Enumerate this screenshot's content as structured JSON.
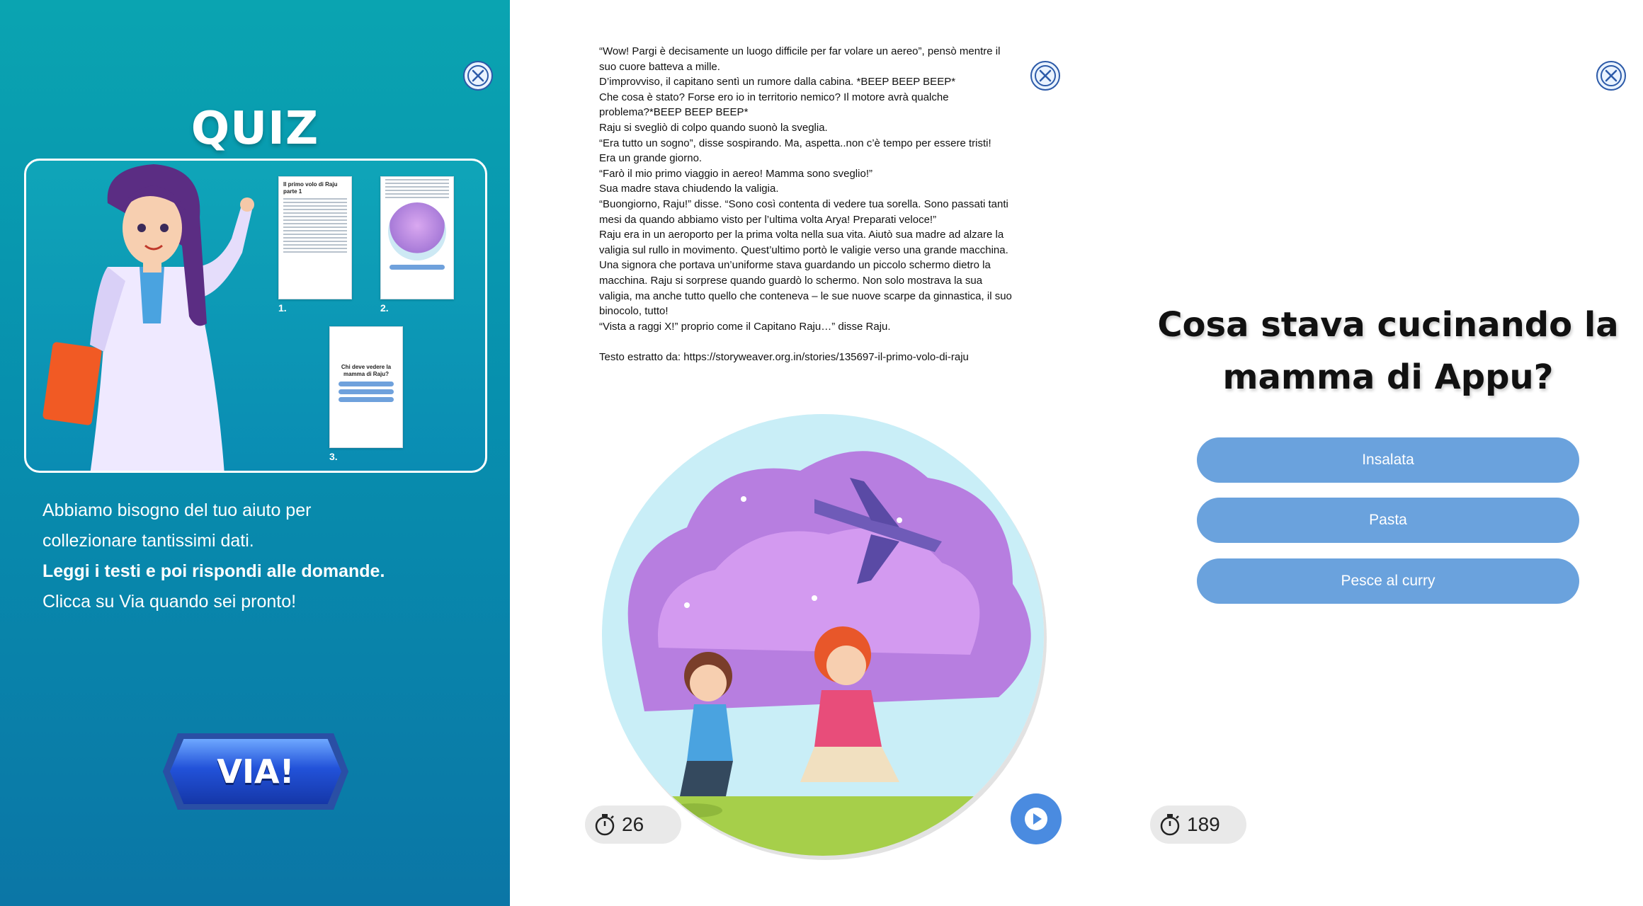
{
  "left": {
    "title": "QUIZ",
    "preview": {
      "thumb1_title": "Il primo volo di Raju parte 1",
      "thumb3_title": "Chi deve vedere la mamma di Raju?",
      "labels": [
        "1.",
        "2.",
        "3."
      ]
    },
    "intro_line1": "Abbiamo bisogno del tuo aiuto per",
    "intro_line2": "collezionare tantissimi dati.",
    "intro_bold": "Leggi i testi e poi rispondi alle domande.",
    "intro_line4": "Clicca su Via quando sei pronto!",
    "start_button": "VIA!"
  },
  "story": {
    "lines": [
      "“Wow! Pargi è decisamente un luogo difficile per far volare un aereo”, pensò mentre il",
      "suo cuore batteva a mille.",
      "D’improvviso, il capitano sentì un rumore dalla cabina. *BEEP BEEP BEEP*",
      "Che cosa è stato? Forse ero io in territorio nemico? Il motore avrà qualche",
      "problema?*BEEP BEEP BEEP*",
      "Raju si svegliò di colpo quando suonò la sveglia.",
      "“Era tutto un sogno”, disse sospirando. Ma, aspetta..non c’è tempo per essere tristi!",
      "Era un grande giorno.",
      "“Farò il mio primo viaggio in aereo! Mamma sono sveglio!”",
      "Sua madre stava chiudendo la valigia.",
      "“Buongiorno, Raju!” disse. “Sono così contenta di vedere tua sorella. Sono passati tanti",
      "mesi da quando abbiamo visto per l’ultima volta Arya! Preparati veloce!”",
      "Raju era in un aeroporto per la prima volta nella sua vita. Aiutò sua madre ad alzare la",
      "valigia sul rullo in movimento. Quest’ultimo portò le valigie verso una grande macchina.",
      "Una signora che portava un’uniforme stava guardando un piccolo schermo dietro la",
      "macchina. Raju si sorprese quando guardò lo schermo. Non solo mostrava la sua",
      "valigia, ma anche tutto quello che conteneva – le sue nuove scarpe da ginnastica, il suo",
      "binocolo, tutto!",
      "“Vista a raggi X!” proprio come il Capitano Raju…” disse Raju."
    ],
    "source": "Testo estratto da: https://storyweaver.org.in/stories/135697-il-primo-volo-di-raju",
    "timer": "26"
  },
  "quiz": {
    "question": "Cosa stava cucinando la mamma di Appu?",
    "answers": [
      "Insalata",
      "Pasta",
      "Pesce al curry"
    ],
    "timer": "189"
  },
  "colors": {
    "answer_bg": "#6aa2dd",
    "panel_teal": "#0aa4b1",
    "play_blue": "#4a8be0"
  }
}
